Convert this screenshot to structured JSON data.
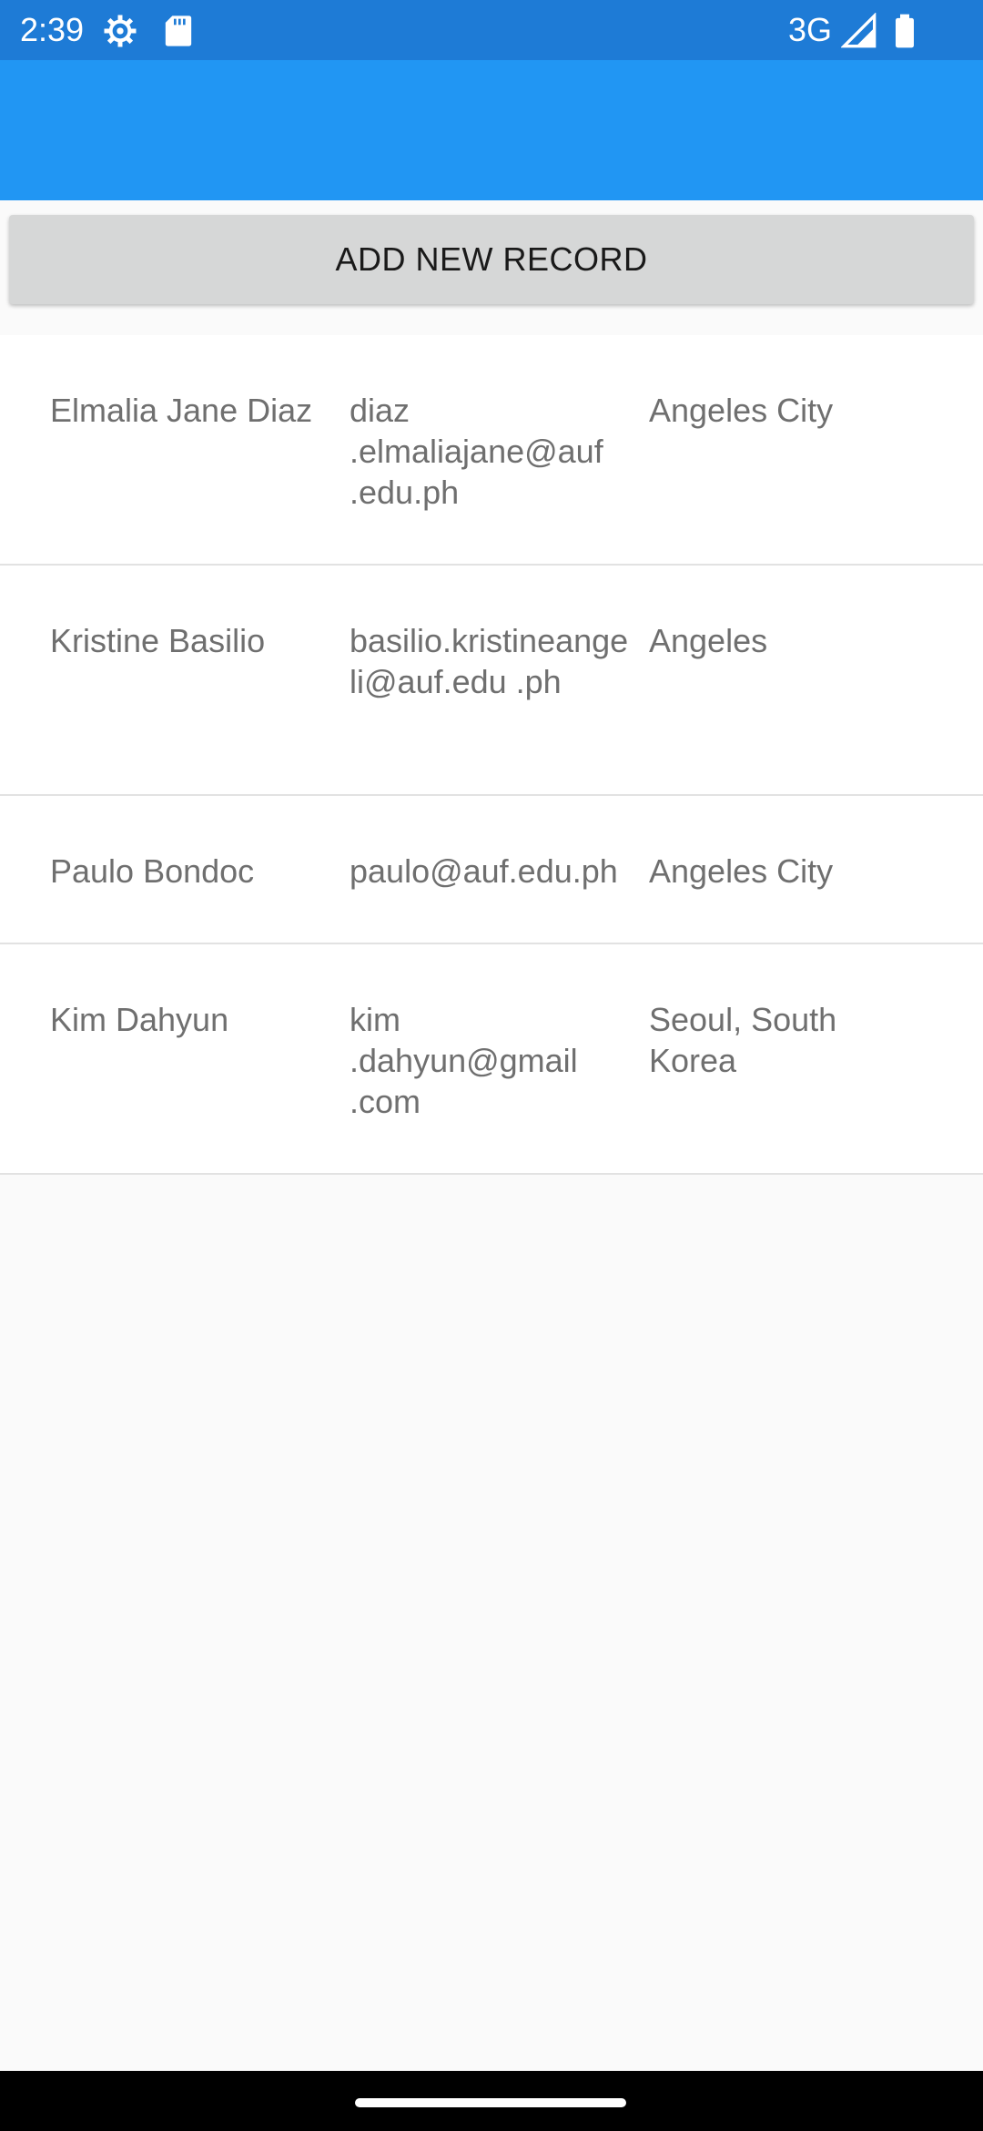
{
  "status_bar": {
    "time": "2:39",
    "network": "3G",
    "icons": [
      "gear-icon",
      "sd-card-icon",
      "signal-icon",
      "battery-icon"
    ]
  },
  "colors": {
    "status_bar": "#1e7bd6",
    "app_bar": "#2196f3",
    "button": "#d6d7d7",
    "background": "#fafafa",
    "text": "#6f6f6f"
  },
  "toolbar": {
    "add_label": "ADD NEW RECORD"
  },
  "records": [
    {
      "name": "Elmalia Jane Diaz",
      "email": "diaz .elmaliajane@auf .edu.ph",
      "city": "Angeles City"
    },
    {
      "name": "Kristine Basilio",
      "email": "basilio.kristineangeli@auf.edu .ph",
      "city": "Angeles"
    },
    {
      "name": "Paulo Bondoc",
      "email": "paulo@auf.edu.ph",
      "city": "Angeles City"
    },
    {
      "name": "Kim Dahyun",
      "email": "kim .dahyun@gmail .com",
      "city": "Seoul, South Korea"
    }
  ]
}
